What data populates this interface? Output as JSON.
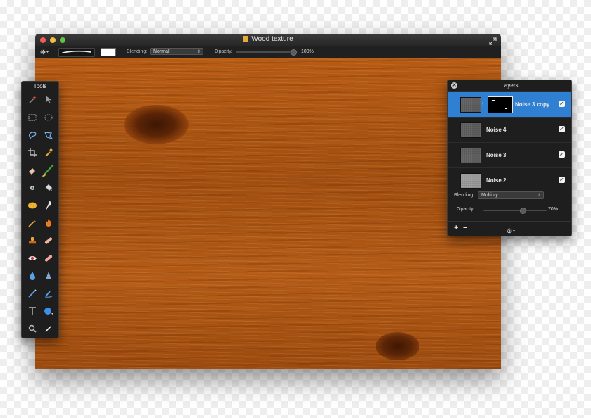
{
  "window": {
    "title": "Wood texture"
  },
  "toolbar": {
    "blending_label": "Blending:",
    "blending_value": "Normal",
    "opacity_label": "Opacity:",
    "opacity_value": "100%",
    "opacity_fraction": 1.0,
    "color_swatch": "#ffffff"
  },
  "tools_palette": {
    "title": "Tools",
    "icons": [
      "magic-wand-icon",
      "move-arrow-icon",
      "rect-select-icon",
      "ellipse-select-icon",
      "lasso-icon",
      "polygon-lasso-icon",
      "crop-icon",
      "eyedropper-icon",
      "eraser-icon",
      "paintbrush-icon",
      "sharpen-icon",
      "paint-bucket-icon",
      "sponge-icon",
      "smudge-icon",
      "burn-icon",
      "flame-icon",
      "stamp-icon",
      "healing-bandage-icon",
      "red-eye-icon",
      "soft-eraser-icon",
      "blur-drop-icon",
      "sharpen-cone-icon",
      "pen-icon",
      "freeform-pen-icon",
      "text-tool-icon",
      "shape-tool-icon",
      "zoom-icon",
      "color-picker-brush-icon"
    ]
  },
  "layers_panel": {
    "title": "Layers",
    "layers": [
      {
        "name": "Noise 3 copy",
        "selected": true,
        "visible": true,
        "has_mask": true
      },
      {
        "name": "Noise 4",
        "selected": false,
        "visible": true,
        "has_mask": false
      },
      {
        "name": "Noise 3",
        "selected": false,
        "visible": true,
        "has_mask": false
      },
      {
        "name": "Noise 2",
        "selected": false,
        "visible": true,
        "has_mask": false
      }
    ],
    "blending_label": "Blending:",
    "blending_value": "Multiply",
    "opacity_label": "Opacity:",
    "opacity_value": "70%",
    "opacity_fraction": 0.7,
    "selection_color": "#2f7fd3"
  },
  "colors": {
    "wood_base": "#a7500f",
    "panel_bg": "#1e1e1e",
    "close_button": "#f25a55",
    "minimize_button": "#f3be3d",
    "zoom_button": "#5fc442"
  }
}
